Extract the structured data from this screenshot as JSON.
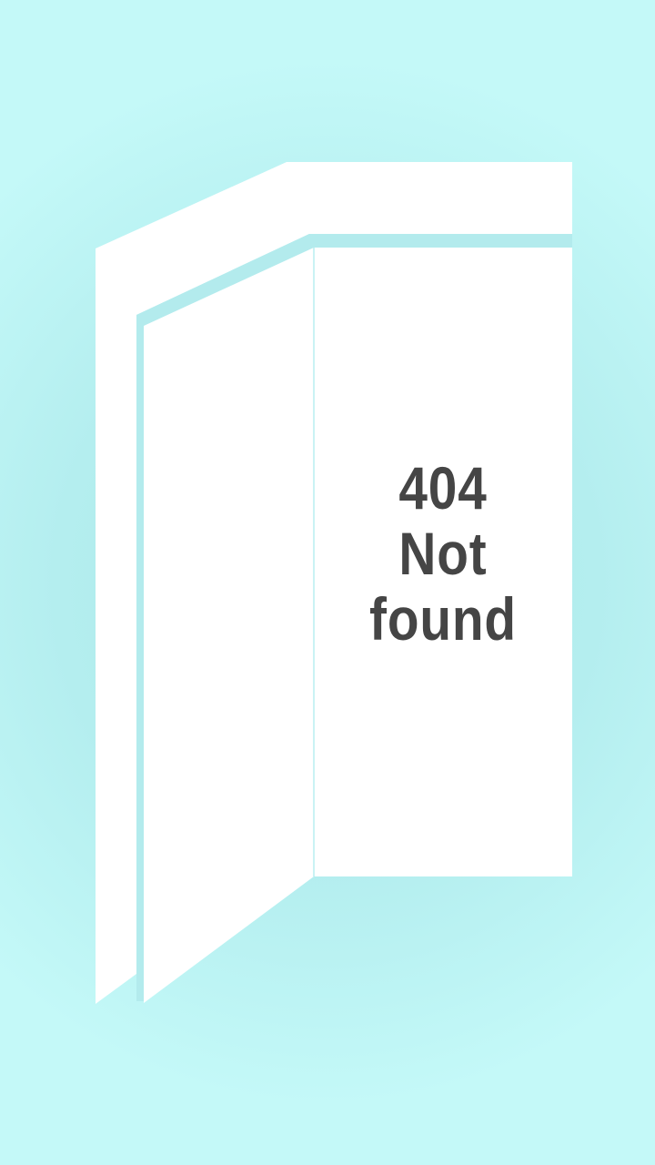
{
  "error": {
    "code": "404",
    "line1": "Not",
    "line2": "found"
  },
  "colors": {
    "background_center": "#a9e7e9",
    "background_edge": "#c4f9f8",
    "door_frame": "#ffffff",
    "door_edge": "#b5ecee",
    "text": "#454545"
  },
  "illustration": {
    "icon": "open-door-icon"
  }
}
